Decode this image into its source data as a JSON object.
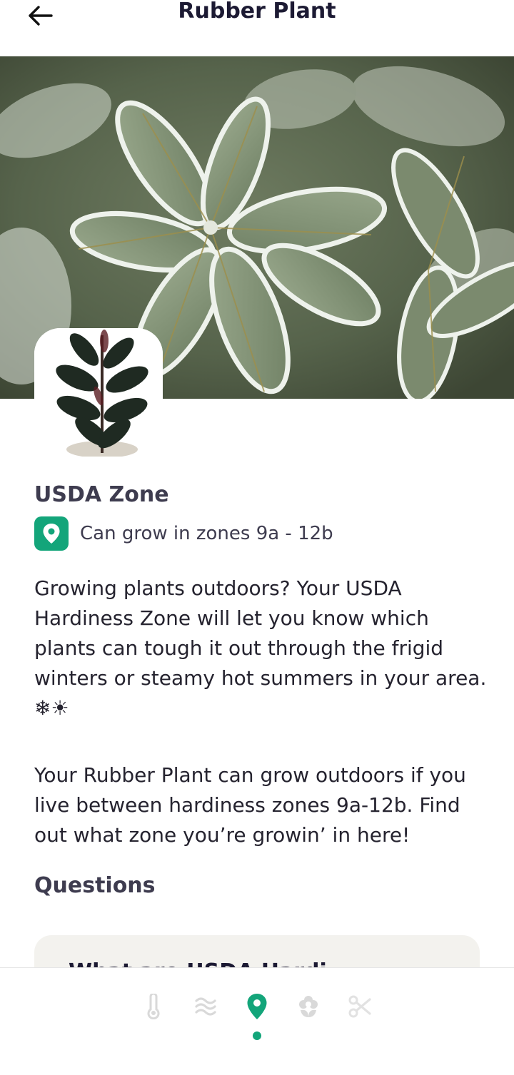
{
  "header": {
    "title": "Rubber Plant",
    "back_icon": "arrow-left-icon"
  },
  "usda": {
    "title": "USDA Zone",
    "zone_text": "Can grow in zones 9a - 12b",
    "icon": "location-pin-icon",
    "accent_color": "#13a57a"
  },
  "description": {
    "paragraph_1": "Growing plants outdoors? Your USDA Hardiness Zone will let you know which plants can tough it out through the frigid winters or steamy hot summers in your area. ❄☀",
    "paragraph_2": "Your Rubber Plant can grow outdoors if you live between hardiness zones 9a-12b. Find out what zone you’re growin’ in here!"
  },
  "questions": {
    "title": "Questions",
    "first_question_partial": "What are USDA Hardi..."
  },
  "bottom_nav": {
    "items": [
      {
        "icon": "thermometer-icon",
        "active": false
      },
      {
        "icon": "humidity-waves-icon",
        "active": false
      },
      {
        "icon": "location-pin-icon",
        "active": true
      },
      {
        "icon": "flower-icon",
        "active": false
      },
      {
        "icon": "scissors-icon",
        "active": false
      }
    ]
  }
}
